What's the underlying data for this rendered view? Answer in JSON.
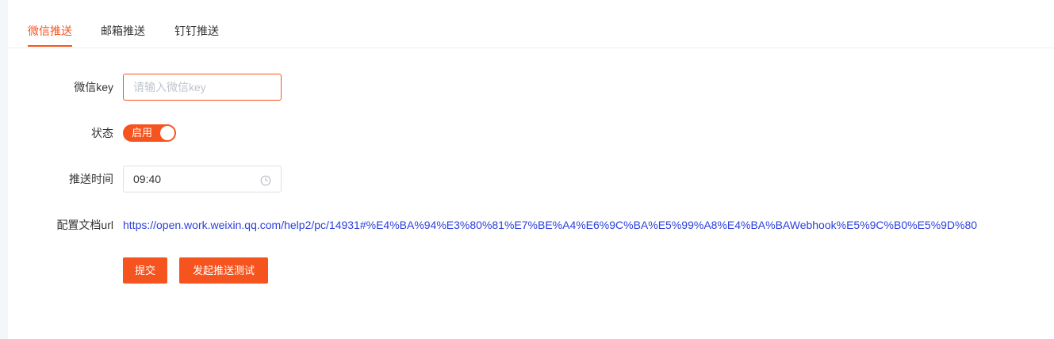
{
  "tabs": [
    {
      "label": "微信推送",
      "active": true
    },
    {
      "label": "邮箱推送",
      "active": false
    },
    {
      "label": "钉钉推送",
      "active": false
    }
  ],
  "form": {
    "wechat_key_label": "微信key",
    "wechat_key_placeholder": "请输入微信key",
    "wechat_key_value": "",
    "status_label": "状态",
    "status_toggle_text": "启用",
    "status_enabled": true,
    "push_time_label": "推送时间",
    "push_time_value": "09:40",
    "doc_url_label": "配置文档url",
    "doc_url": "https://open.work.weixin.qq.com/help2/pc/14931#%E4%BA%94%E3%80%81%E7%BE%A4%E6%9C%BA%E5%99%A8%E4%BA%BAWebhook%E5%9C%B0%E5%9D%80"
  },
  "buttons": {
    "submit": "提交",
    "test_push": "发起推送测试"
  },
  "colors": {
    "accent": "#f6541f",
    "link": "#2b3fdc",
    "border": "#dcdfe6"
  },
  "icons": {
    "time_field": "clock-icon"
  }
}
